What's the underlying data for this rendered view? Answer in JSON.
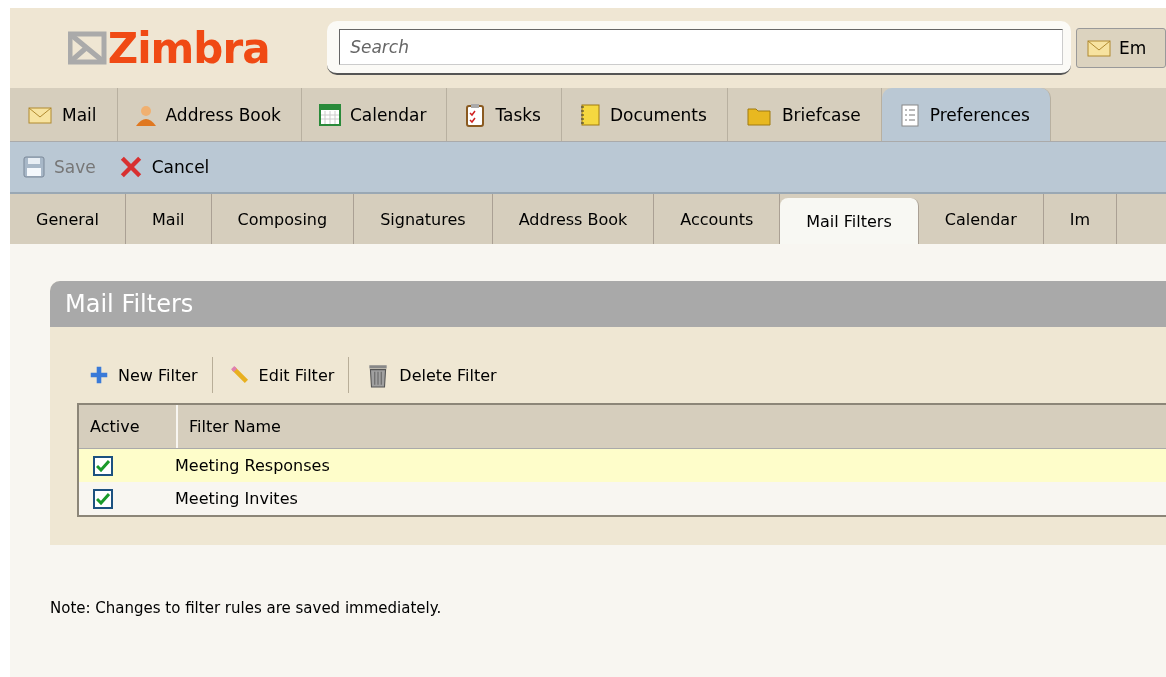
{
  "logo": {
    "text": "Zimbra"
  },
  "search": {
    "placeholder": "Search"
  },
  "search_button": {
    "label": "Em"
  },
  "app_tabs": [
    {
      "label": "Mail",
      "selected": false
    },
    {
      "label": "Address Book",
      "selected": false
    },
    {
      "label": "Calendar",
      "selected": false
    },
    {
      "label": "Tasks",
      "selected": false
    },
    {
      "label": "Documents",
      "selected": false
    },
    {
      "label": "Briefcase",
      "selected": false
    },
    {
      "label": "Preferences",
      "selected": true
    }
  ],
  "toolbar": [
    {
      "label": "Save",
      "disabled": true
    },
    {
      "label": "Cancel",
      "disabled": false
    }
  ],
  "pref_tabs": [
    {
      "label": "General",
      "selected": false
    },
    {
      "label": "Mail",
      "selected": false
    },
    {
      "label": "Composing",
      "selected": false
    },
    {
      "label": "Signatures",
      "selected": false
    },
    {
      "label": "Address Book",
      "selected": false
    },
    {
      "label": "Accounts",
      "selected": false
    },
    {
      "label": "Mail Filters",
      "selected": true
    },
    {
      "label": "Calendar",
      "selected": false
    },
    {
      "label": "Im",
      "selected": false
    }
  ],
  "panel": {
    "title": "Mail Filters",
    "actions": [
      {
        "label": "New Filter"
      },
      {
        "label": "Edit Filter"
      },
      {
        "label": "Delete Filter"
      }
    ],
    "table": {
      "columns": [
        "Active",
        "Filter Name"
      ],
      "rows": [
        {
          "active": true,
          "name": "Meeting Responses",
          "selected": true
        },
        {
          "active": true,
          "name": "Meeting Invites",
          "selected": false
        }
      ]
    }
  },
  "note": "Note: Changes to filter rules are saved immediately."
}
